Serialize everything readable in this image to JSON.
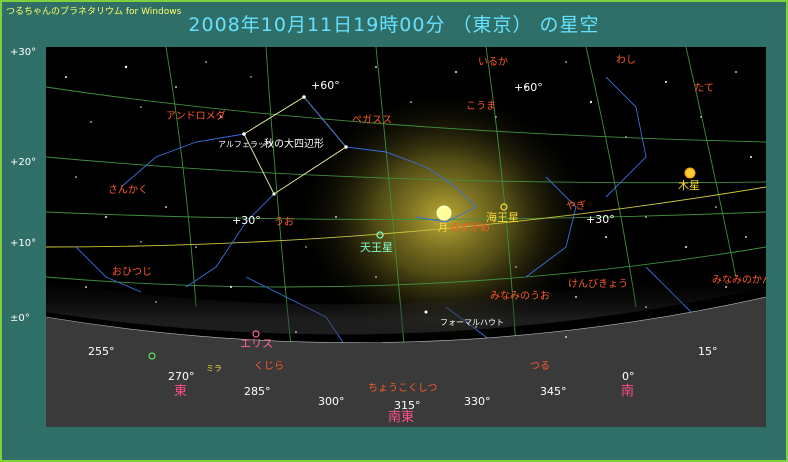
{
  "window": {
    "app_title": "つるちゃんのプラネタリウム for Windows",
    "main_title": "2008年10月11日19時00分 （東京） の星空"
  },
  "altitude_labels": [
    "+30°",
    "+20°",
    "+10°",
    "±0°"
  ],
  "azimuth_labels": [
    {
      "text": "255°",
      "color": "#ffffff"
    },
    {
      "text": "270°",
      "color": "#ffffff"
    },
    {
      "text": "285°",
      "color": "#ffffff"
    },
    {
      "text": "300°",
      "color": "#ffffff"
    },
    {
      "text": "315°",
      "color": "#ffffff"
    },
    {
      "text": "330°",
      "color": "#ffffff"
    },
    {
      "text": "345°",
      "color": "#ffffff"
    },
    {
      "text": "0°",
      "color": "#ffffff"
    },
    {
      "text": "15°",
      "color": "#ffffff"
    }
  ],
  "directions": [
    {
      "text": "東",
      "color": "#ff4d8a"
    },
    {
      "text": "南東",
      "color": "#ff4d8a"
    },
    {
      "text": "南",
      "color": "#ff4d8a"
    }
  ],
  "declination_labels": [
    "+60°",
    "+60°",
    "+30°",
    "+30°"
  ],
  "constellations": [
    "いるか",
    "わし",
    "こうま",
    "たて",
    "アンドロメダ",
    "ペガスス",
    "さんかく",
    "うお",
    "やぎ",
    "おひつじ",
    "みなみのうお",
    "けんびきょう",
    "みなみのかんむり",
    "くじら",
    "ちょうこくしつ",
    "つる"
  ],
  "asterisms": [
    "秋の大四辺形",
    "アルフェラッツ",
    "フォーマルハウト",
    "ミラ"
  ],
  "planets": [
    {
      "name": "月",
      "symbol": "moon"
    },
    {
      "name": "木星",
      "symbol": "jupiter"
    },
    {
      "name": "海王星",
      "symbol": "neptune"
    },
    {
      "name": "天王星",
      "symbol": "uranus"
    },
    {
      "name": "エリス",
      "symbol": "eris"
    },
    {
      "name": "みずがめ",
      "symbol": "constellation"
    }
  ],
  "colors": {
    "frame": "#2f6f68",
    "border": "#7fd13b",
    "sky": "#000000",
    "horizon": "#3a3a3a",
    "title": "#66e0ff",
    "constellation_label": "#ff5a2a",
    "planet_label": "#ffdc3c",
    "direction": "#ff4d8a"
  }
}
